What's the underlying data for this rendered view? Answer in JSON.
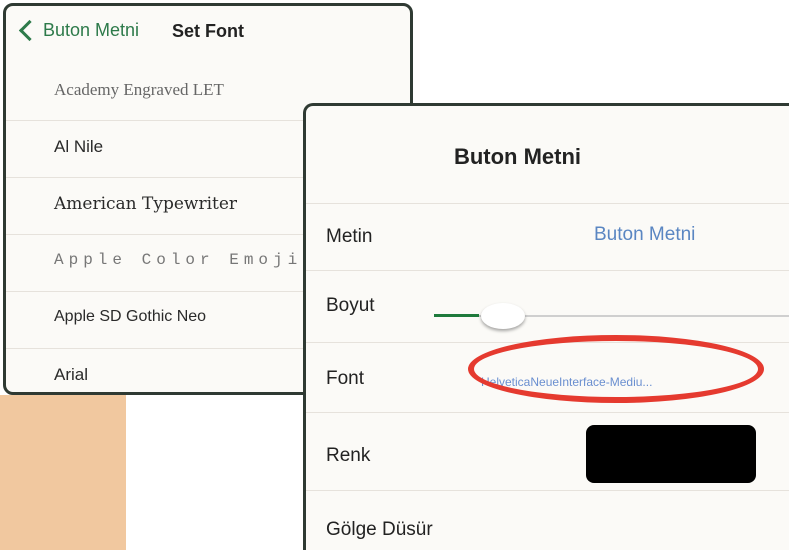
{
  "font_picker": {
    "back_label": "Buton Metni",
    "title": "Set Font",
    "fonts": [
      "Academy Engraved LET",
      "Al Nile",
      "American Typewriter",
      "Apple Color Emoji",
      "Apple SD Gothic Neo",
      "Arial"
    ]
  },
  "button_settings": {
    "title": "Buton Metni",
    "rows": {
      "metin": {
        "label": "Metin",
        "value": "Buton Metni"
      },
      "boyut": {
        "label": "Boyut"
      },
      "font": {
        "label": "Font",
        "value": "HelveticaNeueInterface-Mediu..."
      },
      "renk": {
        "label": "Renk",
        "color": "#000000"
      },
      "golge": {
        "label": "Gölge Düsür"
      }
    }
  },
  "colors": {
    "accent_green": "#2d7a4a",
    "link_blue": "#5a86c2",
    "highlight_red": "#e53a2f"
  }
}
